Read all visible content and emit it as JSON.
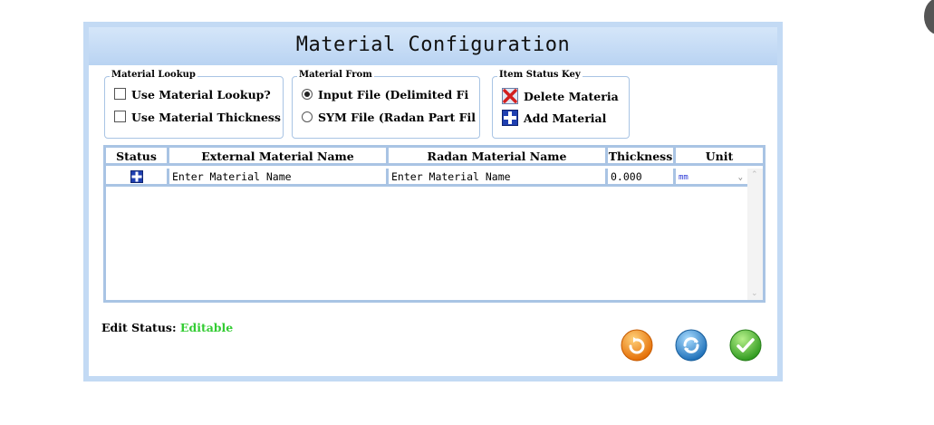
{
  "window": {
    "title": "Material Configuration"
  },
  "material_lookup": {
    "legend": "Material Lookup",
    "options": [
      {
        "label": "Use Material Lookup?",
        "checked": false
      },
      {
        "label": "Use Material Thickness'",
        "checked": false
      }
    ]
  },
  "material_from": {
    "legend": "Material From",
    "options": [
      {
        "label": "Input File (Delimited Fi",
        "selected": true
      },
      {
        "label": "SYM File (Radan Part Fil",
        "selected": false
      }
    ]
  },
  "status_key": {
    "legend": "Item Status Key",
    "items": [
      {
        "label": "Delete Materia",
        "icon": "delete-x-icon"
      },
      {
        "label": "Add Material",
        "icon": "add-plus-icon"
      }
    ]
  },
  "grid": {
    "columns": [
      "Status",
      "External Material Name",
      "Radan Material Name",
      "Thickness",
      "Unit"
    ],
    "rows": [
      {
        "status_icon": "add-plus-icon",
        "external": "Enter Material Name",
        "radan": "Enter Material Name",
        "thickness": "0.000",
        "unit": "mm"
      }
    ]
  },
  "edit_status": {
    "label": "Edit Status:",
    "value": "Editable",
    "value_color": "#33cc33"
  },
  "actions": [
    {
      "name": "undo-button",
      "icon": "undo-icon",
      "color": "#f08a1a"
    },
    {
      "name": "refresh-button",
      "icon": "refresh-icon",
      "color": "#2f86c9"
    },
    {
      "name": "confirm-button",
      "icon": "checkmark-icon",
      "color": "#36b02f"
    }
  ]
}
